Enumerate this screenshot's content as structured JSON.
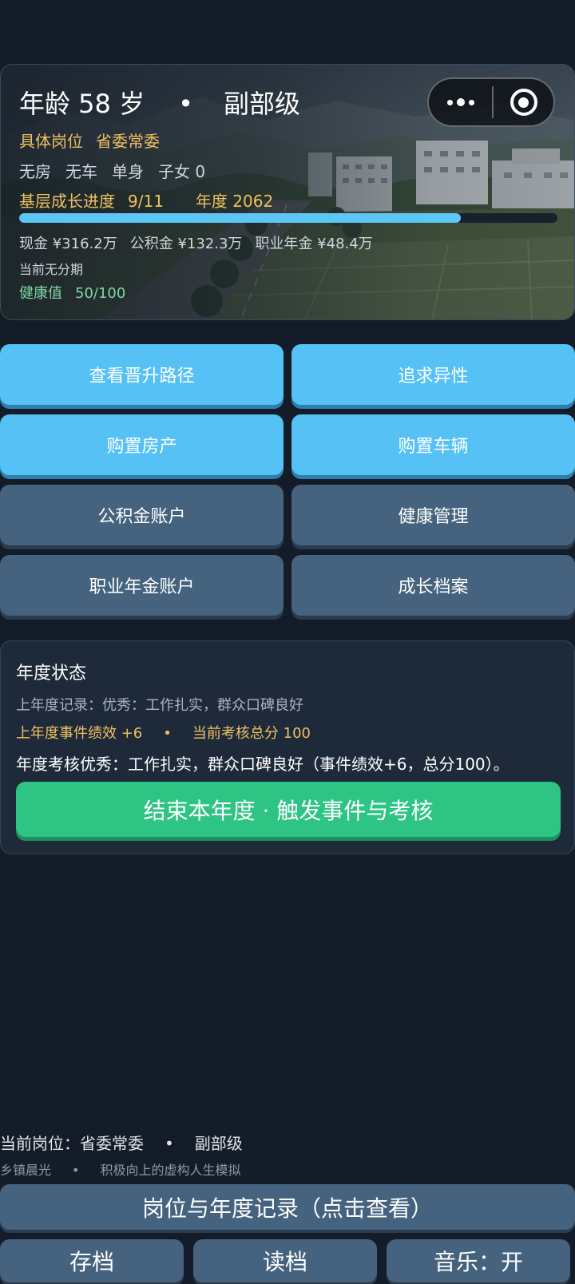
{
  "header": {
    "title": "年龄 58 岁",
    "dot": "•",
    "rank": "副部级",
    "post_label": "具体岗位",
    "post_value": "省委常委",
    "life": [
      "无房",
      "无车",
      "单身",
      "子女 0"
    ],
    "growth_label": "基层成长进度",
    "growth_value": "9/11",
    "year_label": "年度 2062",
    "growth_progress": 0.82,
    "money": [
      "现金 ¥316.2万",
      "公积金 ¥132.3万",
      "职业年金 ¥48.4万"
    ],
    "installment": "当前无分期",
    "health_label": "健康值",
    "health_value": "50/100"
  },
  "actions": [
    {
      "label": "查看晋升路径",
      "style": "blue"
    },
    {
      "label": "追求异性",
      "style": "blue"
    },
    {
      "label": "购置房产",
      "style": "blue"
    },
    {
      "label": "购置车辆",
      "style": "blue"
    },
    {
      "label": "公积金账户",
      "style": "slate"
    },
    {
      "label": "健康管理",
      "style": "slate"
    },
    {
      "label": "职业年金账户",
      "style": "slate"
    },
    {
      "label": "成长档案",
      "style": "slate"
    }
  ],
  "status": {
    "title": "年度状态",
    "record": "上年度记录：优秀：工作扎实，群众口碑良好",
    "perf": "上年度事件绩效 +6",
    "dot": "•",
    "score": "当前考核总分 100",
    "message": "年度考核优秀：工作扎实，群众口碑良好（事件绩效+6，总分100）。",
    "end_button": "结束本年度 · 触发事件与考核"
  },
  "footer": {
    "current_post": "当前岗位：省委常委",
    "dot": "•",
    "rank": "副部级",
    "app_name": "乡镇晨光",
    "tagline": "积极向上的虚构人生模拟",
    "records_button": "岗位与年度记录（点击查看）",
    "save_button": "存档",
    "load_button": "读档",
    "music_button": "音乐：开"
  },
  "colors": {
    "accent_blue": "#55c1f5",
    "accent_green": "#2ec584",
    "gold_text": "#f0c060",
    "slate_button": "#45627e",
    "health_text": "#7fd6a6"
  }
}
